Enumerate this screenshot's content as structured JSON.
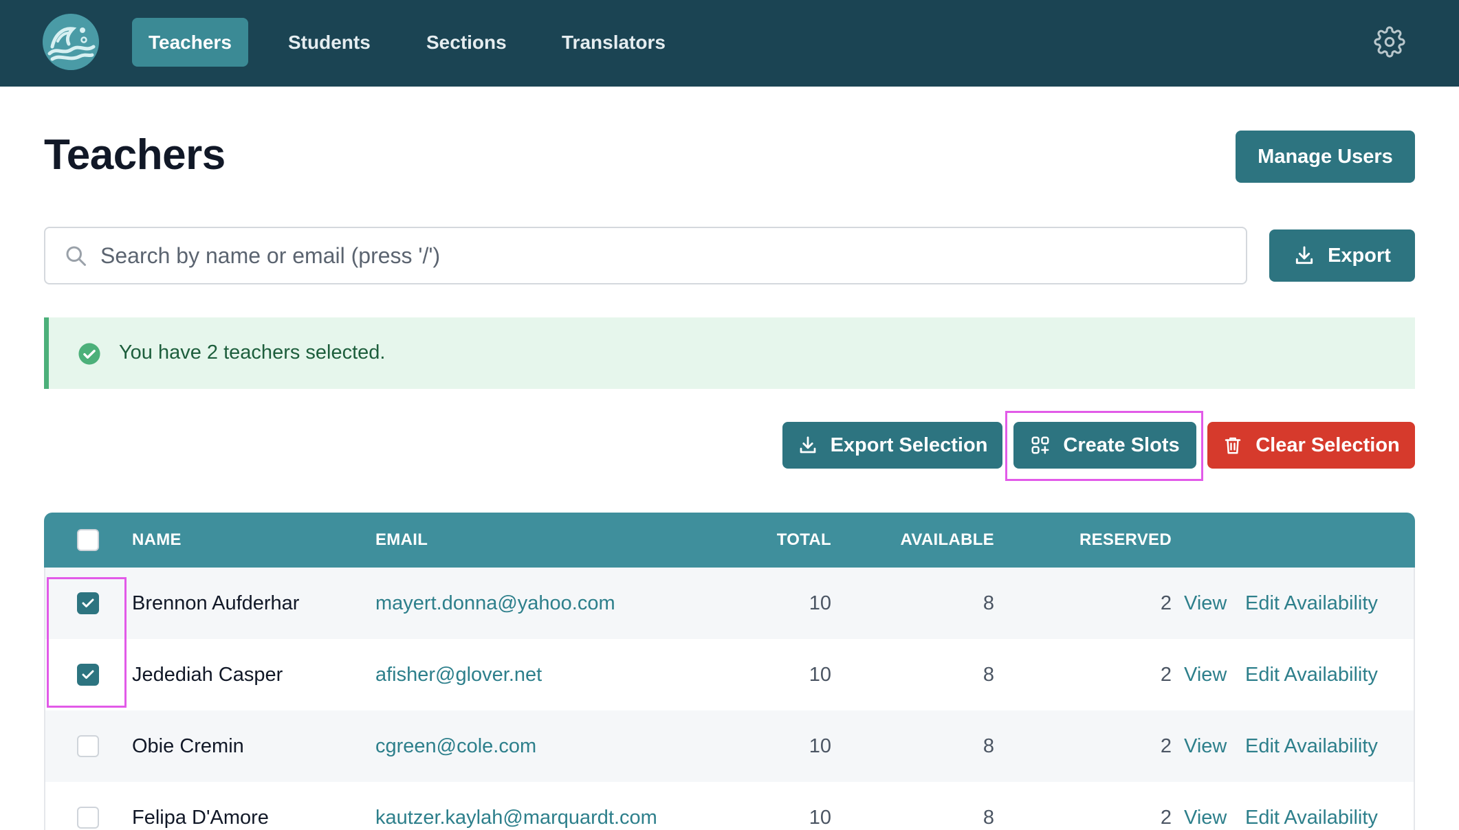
{
  "nav": {
    "tabs": [
      {
        "label": "Teachers",
        "active": true
      },
      {
        "label": "Students",
        "active": false
      },
      {
        "label": "Sections",
        "active": false
      },
      {
        "label": "Translators",
        "active": false
      }
    ]
  },
  "page": {
    "title": "Teachers",
    "manage_users_label": "Manage Users"
  },
  "search": {
    "placeholder": "Search by name or email (press '/')",
    "value": ""
  },
  "export_label": "Export",
  "alert": {
    "text": "You have 2 teachers selected."
  },
  "actions": {
    "export_selection": "Export Selection",
    "create_slots": "Create Slots",
    "clear_selection": "Clear Selection"
  },
  "table": {
    "headers": {
      "name": "NAME",
      "email": "EMAIL",
      "total": "TOTAL",
      "available": "AVAILABLE",
      "reserved": "RESERVED"
    },
    "rows": [
      {
        "checked": true,
        "name": "Brennon Aufderhar",
        "email": "mayert.donna@yahoo.com",
        "total": "10",
        "available": "8",
        "reserved": "2",
        "view": "View",
        "edit": "Edit Availability"
      },
      {
        "checked": true,
        "name": "Jedediah Casper",
        "email": "afisher@glover.net",
        "total": "10",
        "available": "8",
        "reserved": "2",
        "view": "View",
        "edit": "Edit Availability"
      },
      {
        "checked": false,
        "name": "Obie Cremin",
        "email": "cgreen@cole.com",
        "total": "10",
        "available": "8",
        "reserved": "2",
        "view": "View",
        "edit": "Edit Availability"
      },
      {
        "checked": false,
        "name": "Felipa D'Amore",
        "email": "kautzer.kaylah@marquardt.com",
        "total": "10",
        "available": "8",
        "reserved": "2",
        "view": "View",
        "edit": "Edit Availability"
      }
    ]
  },
  "colors": {
    "navbar": "#1b4453",
    "primary": "#2d7480",
    "table_header": "#3f8f9c",
    "danger": "#d63a2c",
    "success_bg": "#e6f6ec",
    "highlight": "#e25ae8"
  },
  "icons": [
    "logo-wave-icon",
    "gear-icon",
    "search-icon",
    "download-icon",
    "check-circle-icon",
    "grid-plus-icon",
    "trash-icon",
    "checkmark-icon"
  ]
}
